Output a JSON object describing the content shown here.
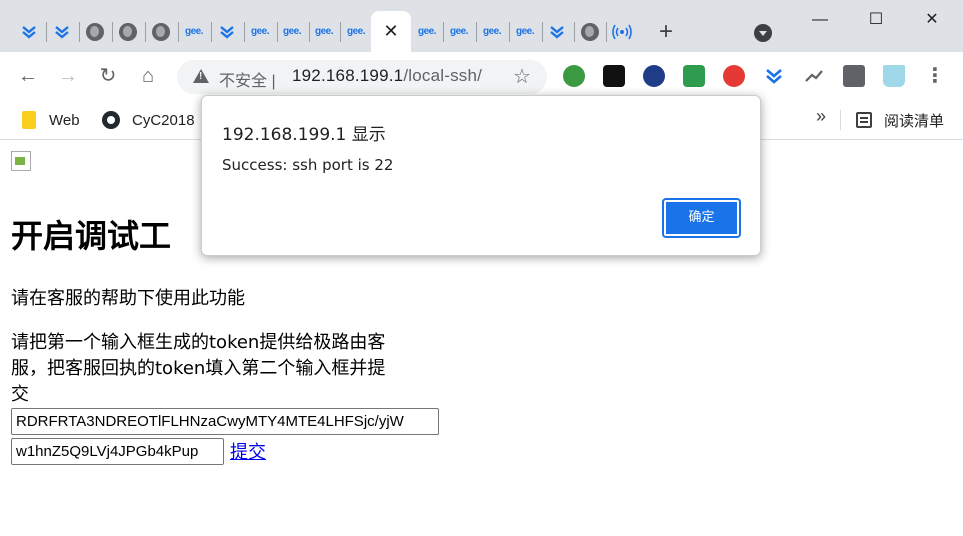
{
  "browser": {
    "tabs": [
      {
        "icon": "downloads-icon"
      },
      {
        "icon": "downloads-icon"
      },
      {
        "icon": "globe-icon"
      },
      {
        "icon": "globe-icon"
      },
      {
        "icon": "globe-icon"
      },
      {
        "icon": "gee-icon",
        "label": "gee."
      },
      {
        "icon": "downloads-icon"
      },
      {
        "icon": "gee-icon",
        "label": "gee."
      },
      {
        "icon": "gee-icon",
        "label": "gee."
      },
      {
        "icon": "gee-icon",
        "label": "gee."
      },
      {
        "icon": "gee-icon",
        "label": "gee."
      },
      {
        "icon": "close-icon",
        "active": true
      },
      {
        "icon": "gee-icon",
        "label": "gee."
      },
      {
        "icon": "gee-icon",
        "label": "gee."
      },
      {
        "icon": "gee-icon",
        "label": "gee."
      },
      {
        "icon": "gee-icon",
        "label": "gee."
      },
      {
        "icon": "downloads-icon"
      },
      {
        "icon": "globe-icon"
      },
      {
        "icon": "broadcast-icon"
      }
    ],
    "gee_label": "gee.",
    "new_tab": "+",
    "window": {
      "minimize": "—",
      "maximize": "☐",
      "close": "✕"
    },
    "toolbar": {
      "back": "←",
      "forward": "→",
      "reload": "↻",
      "home": "⌂",
      "insecure_label": "不安全 |",
      "url_host": "192.168.199.1",
      "url_path": "/local-ssh/",
      "star": "☆",
      "menu": "⋮"
    },
    "bookmarks": {
      "items": [
        {
          "label": "Web",
          "icon": "folder-icon"
        },
        {
          "label": "CyC2018",
          "icon": "github-icon"
        }
      ],
      "overflow": "»",
      "reading_list": "阅读清单"
    }
  },
  "page": {
    "heading": "开启调试工",
    "intro": "请在客服的帮助下使用此功能",
    "instructions": "请把第一个输入框生成的token提供给极路由客服，把客服回执的token填入第二个输入框并提交",
    "token_in": "RDRFRTA3NDREOTlFLHNzaCwyMTY4MTE4LHFSjc/yjW",
    "token_out": "w1hnZ5Q9LVj4JPGb4kPup",
    "submit": "提交"
  },
  "dialog": {
    "title": "192.168.199.1 显示",
    "message": "Success: ssh port is 22",
    "ok": "确定"
  },
  "colors": {
    "accent": "#1a73e8",
    "tabstrip": "#dee1e6",
    "link": "#0000ee"
  }
}
